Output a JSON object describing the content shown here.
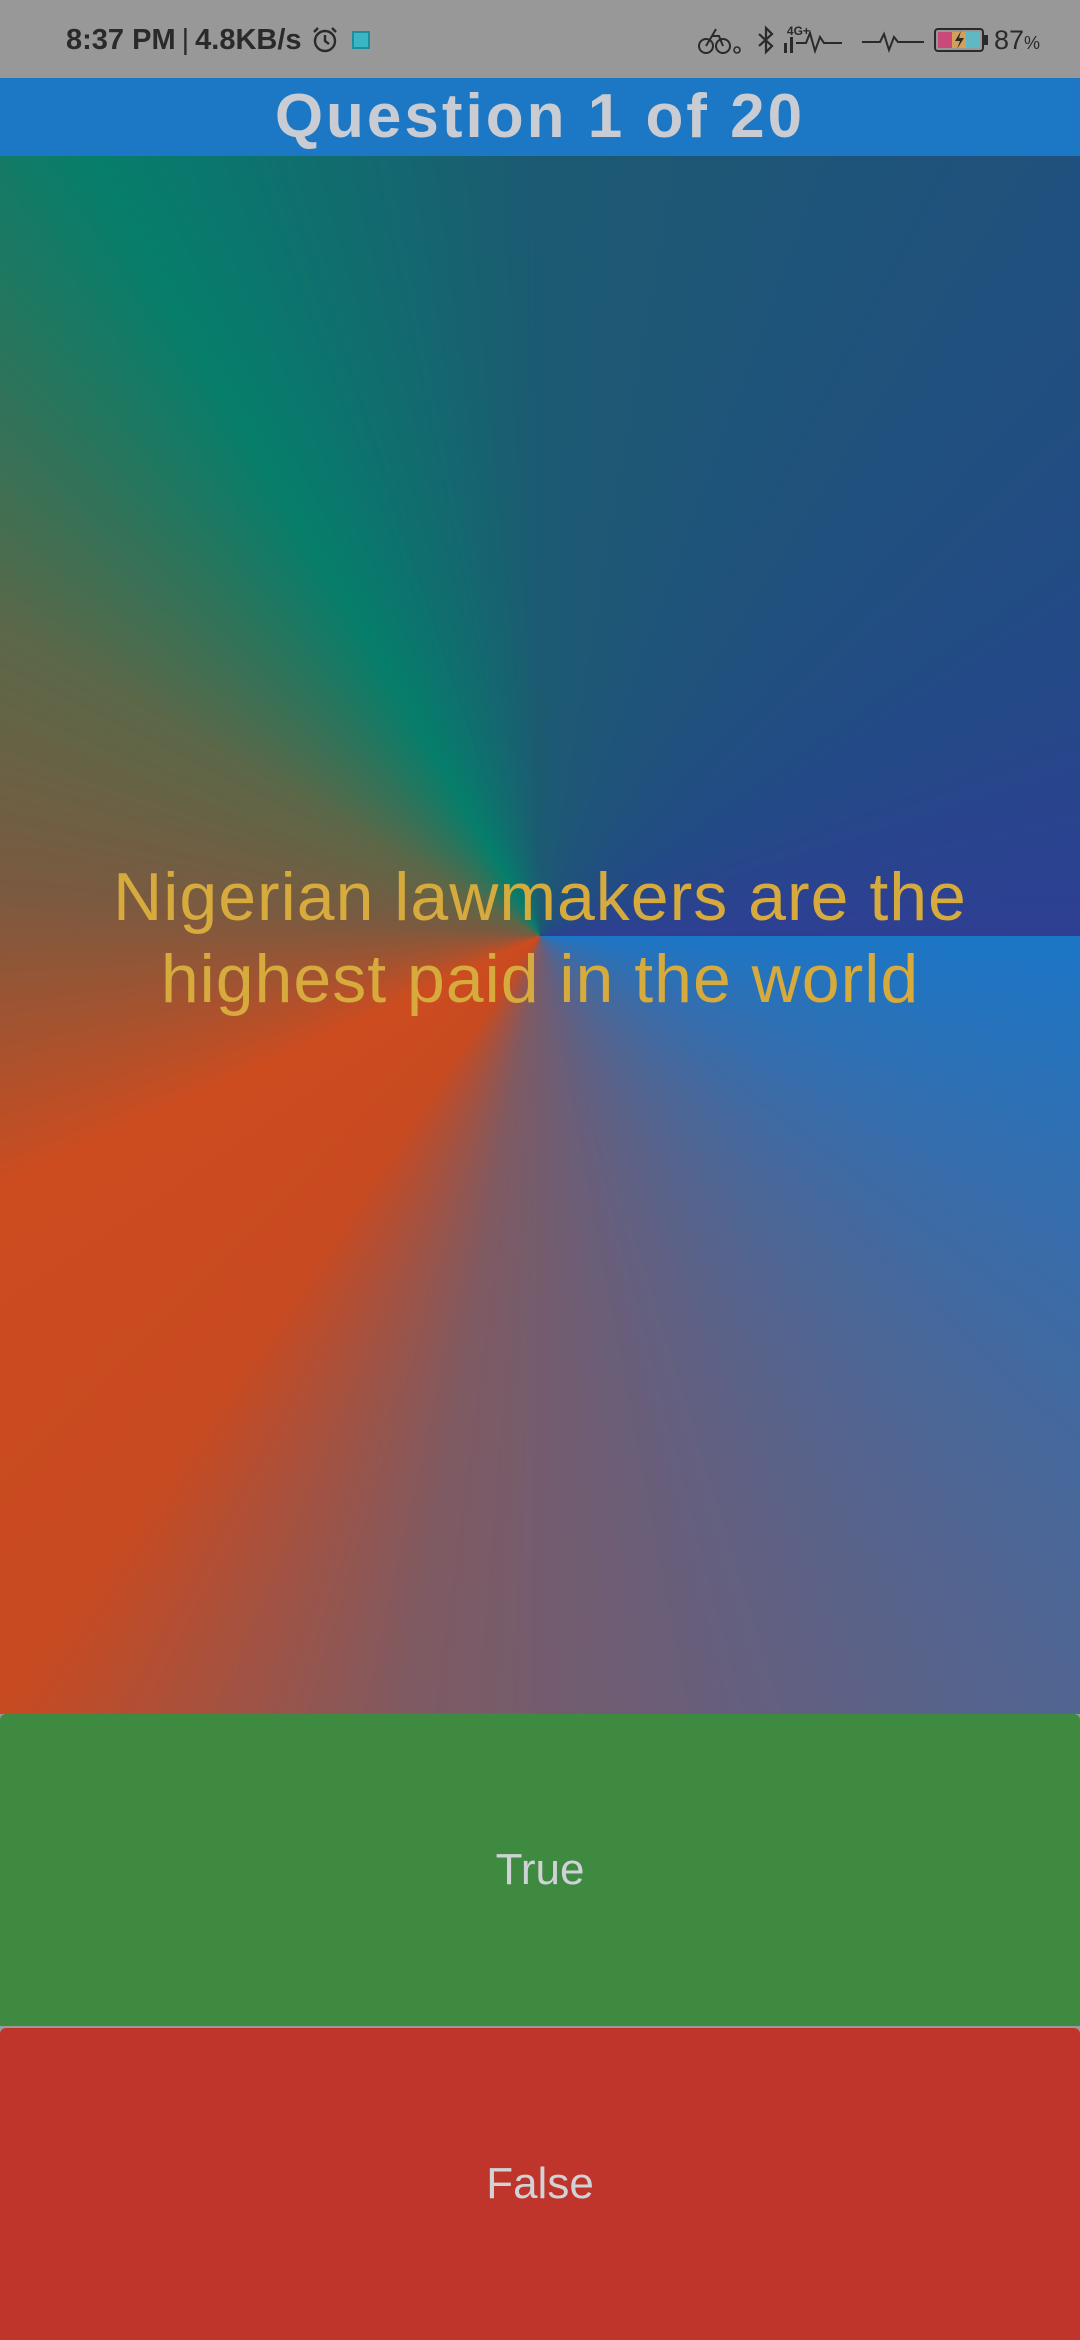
{
  "status_bar": {
    "time": "8:37 PM",
    "separator": "|",
    "net_speed": "4.8KB/s",
    "network_type": "4G+",
    "battery_percent": "87",
    "battery_unit": "%",
    "icons": [
      "alarm-icon",
      "app-notification-icon",
      "cycling-icon",
      "bluetooth-icon",
      "signal-icon",
      "activity-icon",
      "heart-rate-icon",
      "battery-charging-icon"
    ]
  },
  "header": {
    "title": "Question 1 of 20",
    "color": "#1c77c4"
  },
  "question": {
    "text": "Nigerian lawmakers are the highest paid in the world",
    "color": "#d6aa3c"
  },
  "answers": {
    "true_label": "True",
    "true_color": "#3e8a40",
    "false_label": "False",
    "false_color": "#bf342b"
  }
}
